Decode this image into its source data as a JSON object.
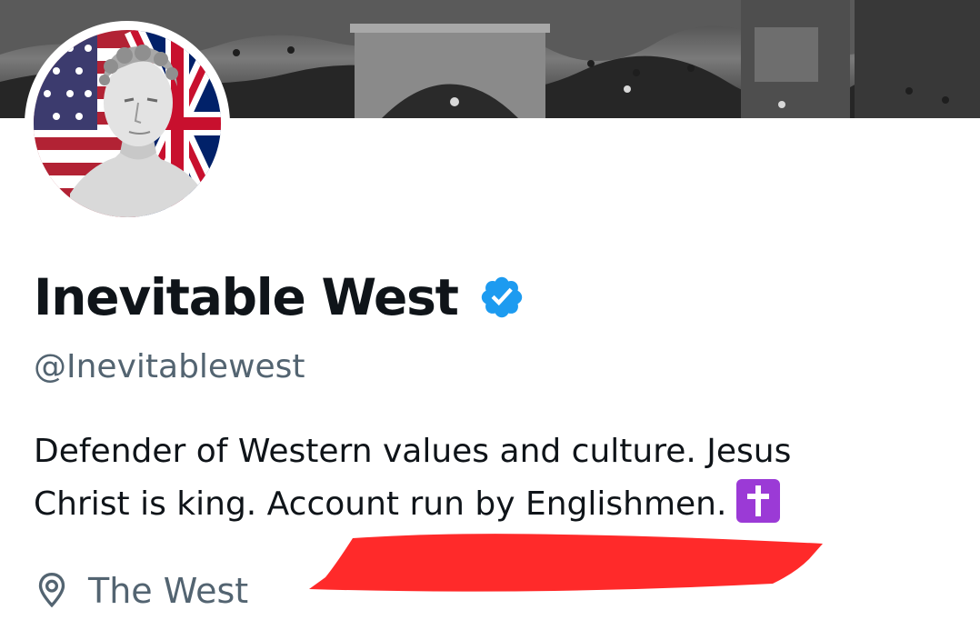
{
  "profile": {
    "display_name": "Inevitable West",
    "handle": "@Inevitablewest",
    "verified": true,
    "bio_line1": "Defender of Western values and culture. Jesus",
    "bio_line2": "Christ is king. Account run by Englishmen.",
    "location": "The West"
  },
  "icons": {
    "verified": "verified-badge-icon",
    "location": "location-pin-icon",
    "bio_emoji": "latin-cross-emoji"
  },
  "colors": {
    "text_primary": "#0f1419",
    "text_secondary": "#536471",
    "verified_blue": "#1d9bf0",
    "emoji_purple": "#9b3ad6",
    "redaction_red": "#ff2a2a"
  }
}
